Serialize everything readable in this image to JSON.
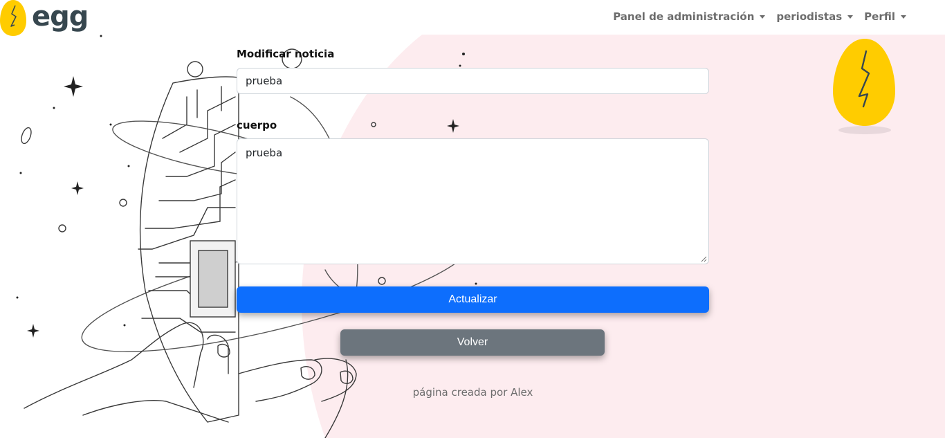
{
  "brand": {
    "name": "egg"
  },
  "nav": {
    "items": [
      {
        "label": "Panel de administración"
      },
      {
        "label": "periodistas"
      },
      {
        "label": "Perfil"
      }
    ]
  },
  "form": {
    "title_label": "Modificar noticia",
    "title_value": "prueba",
    "body_label": "cuerpo",
    "body_value": "prueba",
    "submit_label": "Actualizar",
    "back_label": "Volver"
  },
  "footer": {
    "text": "página creada por Alex"
  },
  "colors": {
    "primary": "#0d6efd",
    "secondary": "#6c757d",
    "egg": "#ffcc00",
    "background_accent": "#fdecef"
  }
}
